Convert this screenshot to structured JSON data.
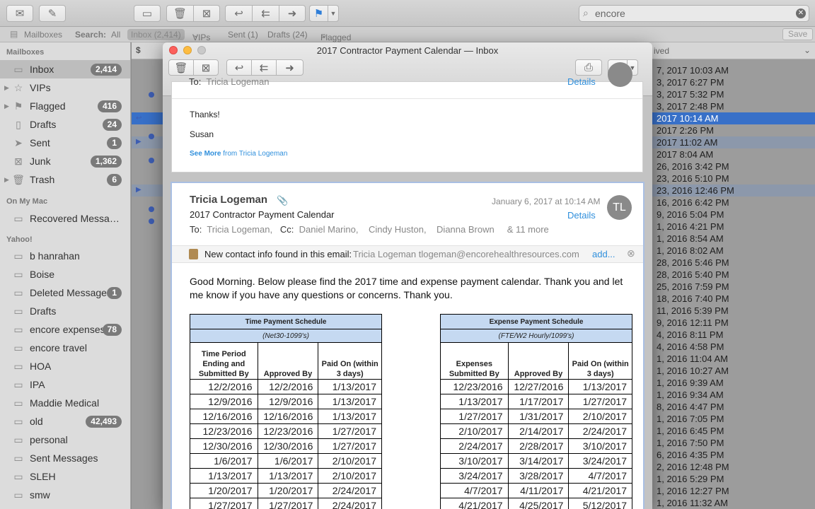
{
  "toolbar": {
    "search_value": "encore"
  },
  "favorites_bar": {
    "mailboxes": "Mailboxes",
    "search_label": "Search:",
    "all": "All",
    "inbox": "Inbox (2,414)",
    "vips": "VIPs",
    "sent": "Sent (1)",
    "drafts": "Drafts (24)",
    "flagged": "Flagged",
    "save": "Save"
  },
  "sidebar": {
    "mailboxes_heading": "Mailboxes",
    "mailboxes": [
      {
        "label": "Inbox",
        "badge": "2,414",
        "icon": "inbox-icon"
      },
      {
        "label": "VIPs",
        "badge": "",
        "icon": "star-icon"
      },
      {
        "label": "Flagged",
        "badge": "416",
        "icon": "flag-icon"
      },
      {
        "label": "Drafts",
        "badge": "24",
        "icon": "document-icon"
      },
      {
        "label": "Sent",
        "badge": "1",
        "icon": "paper-plane-icon"
      },
      {
        "label": "Junk",
        "badge": "1,362",
        "icon": "junk-icon"
      },
      {
        "label": "Trash",
        "badge": "6",
        "icon": "trash-icon"
      }
    ],
    "on_my_mac_heading": "On My Mac",
    "on_my_mac": [
      {
        "label": "Recovered Messages",
        "badge": ""
      }
    ],
    "yahoo_heading": "Yahoo!",
    "yahoo": [
      {
        "label": "b hanrahan",
        "badge": ""
      },
      {
        "label": "Boise",
        "badge": ""
      },
      {
        "label": "Deleted Messages",
        "badge": "1"
      },
      {
        "label": "Drafts",
        "badge": ""
      },
      {
        "label": "encore expenses",
        "badge": "78"
      },
      {
        "label": "encore travel",
        "badge": ""
      },
      {
        "label": "HOA",
        "badge": ""
      },
      {
        "label": "IPA",
        "badge": ""
      },
      {
        "label": "Maddie Medical",
        "badge": ""
      },
      {
        "label": "old",
        "badge": "42,493"
      },
      {
        "label": "personal",
        "badge": ""
      },
      {
        "label": "Sent Messages",
        "badge": ""
      },
      {
        "label": "SLEH",
        "badge": ""
      },
      {
        "label": "smw",
        "badge": ""
      }
    ]
  },
  "message_list": {
    "column_received": "ived",
    "rows": [
      {
        "date": "7, 2017  10:03 AM"
      },
      {
        "date": "3, 2017  6:27 PM"
      },
      {
        "date": "3, 2017  5:32 PM"
      },
      {
        "date": "3, 2017  2:48 PM"
      },
      {
        "date": "2017  10:14 AM"
      },
      {
        "date": "2017  2:26 PM"
      },
      {
        "date": "2017  11:02 AM"
      },
      {
        "date": "2017  8:04 AM"
      },
      {
        "date": "26, 2016  3:42 PM"
      },
      {
        "date": "23, 2016  5:10 PM"
      },
      {
        "date": "23, 2016  12:46 PM"
      },
      {
        "date": "16, 2016  6:42 PM"
      },
      {
        "date": "9, 2016  5:04 PM"
      },
      {
        "date": "1, 2016  4:21 PM"
      },
      {
        "date": "1, 2016  8:54 AM"
      },
      {
        "date": "1, 2016  8:02 AM"
      },
      {
        "date": "28, 2016  5:46 PM"
      },
      {
        "date": "28, 2016  5:40 PM"
      },
      {
        "date": "25, 2016  7:59 PM"
      },
      {
        "date": "18, 2016  7:40 PM"
      },
      {
        "date": "11, 2016  5:39 PM"
      },
      {
        "date": "9, 2016  12:11 PM"
      },
      {
        "date": "4, 2016  8:11 PM"
      },
      {
        "date": "4, 2016  4:58 PM"
      },
      {
        "date": "1, 2016  11:04 AM"
      },
      {
        "date": "1, 2016  10:27 AM"
      },
      {
        "date": "1, 2016  9:39 AM"
      },
      {
        "date": "1, 2016  9:34 AM"
      },
      {
        "date": "8, 2016  4:47 PM"
      },
      {
        "date": "1, 2016  7:05 PM"
      },
      {
        "date": "1, 2016  6:45 PM"
      },
      {
        "date": "1, 2016  7:50 PM"
      },
      {
        "date": "6, 2016  4:35 PM"
      },
      {
        "date": "2, 2016  12:48 PM"
      },
      {
        "date": "1, 2016  5:29 PM"
      },
      {
        "date": "1, 2016  12:27 PM"
      },
      {
        "date": "1, 2016  11:32 AM"
      }
    ]
  },
  "window": {
    "title": "2017 Contractor Payment Calendar — Inbox"
  },
  "prev_message": {
    "to_label": "To:",
    "to": "Tricia Logeman",
    "details": "Details",
    "line1": "Thanks!",
    "line2": "Susan",
    "see_more": "See More",
    "from_text": "from Tricia Logeman"
  },
  "message": {
    "sender": "Tricia Logeman",
    "subject": "2017 Contractor Payment Calendar",
    "date": "January 6, 2017 at 10:14 AM",
    "details": "Details",
    "avatar": "TL",
    "to_label": "To:",
    "to": "Tricia Logeman,",
    "cc_label": "Cc:",
    "cc": [
      "Daniel Marino,",
      "Cindy Huston,",
      "Dianna Brown"
    ],
    "more": "& 11 more",
    "contact_banner": "New contact info found in this email:",
    "contact_info": "Tricia Logeman tlogeman@encorehealthresources.com",
    "add": "add...",
    "body": "Good Morning.  Below please find the 2017 time and expense payment calendar.  Thank you and let me know if you have any questions or concerns.  Thank you."
  },
  "time_table": {
    "title": "Time Payment Schedule",
    "subtitle": "(Net30-1099's)",
    "headers": [
      "Time Period Ending and Submitted By",
      "Approved By",
      "Paid On (within 3 days)"
    ],
    "rows": [
      [
        "12/2/2016",
        "12/2/2016",
        "1/13/2017"
      ],
      [
        "12/9/2016",
        "12/9/2016",
        "1/13/2017"
      ],
      [
        "12/16/2016",
        "12/16/2016",
        "1/13/2017"
      ],
      [
        "12/23/2016",
        "12/23/2016",
        "1/27/2017"
      ],
      [
        "12/30/2016",
        "12/30/2016",
        "1/27/2017"
      ],
      [
        "1/6/2017",
        "1/6/2017",
        "2/10/2017"
      ],
      [
        "1/13/2017",
        "1/13/2017",
        "2/10/2017"
      ],
      [
        "1/20/2017",
        "1/20/2017",
        "2/24/2017"
      ],
      [
        "1/27/2017",
        "1/27/2017",
        "2/24/2017"
      ]
    ]
  },
  "expense_table": {
    "title": "Expense Payment Schedule",
    "subtitle": "(FTE/W2 Hourly/1099's)",
    "headers": [
      "Expenses Submitted By",
      "Approved By",
      "Paid On (within 3 days)"
    ],
    "rows": [
      [
        "12/23/2016",
        "12/27/2016",
        "1/13/2017"
      ],
      [
        "1/13/2017",
        "1/17/2017",
        "1/27/2017"
      ],
      [
        "1/27/2017",
        "1/31/2017",
        "2/10/2017"
      ],
      [
        "2/10/2017",
        "2/14/2017",
        "2/24/2017"
      ],
      [
        "2/24/2017",
        "2/28/2017",
        "3/10/2017"
      ],
      [
        "3/10/2017",
        "3/14/2017",
        "3/24/2017"
      ],
      [
        "3/24/2017",
        "3/28/2017",
        "4/7/2017"
      ],
      [
        "4/7/2017",
        "4/11/2017",
        "4/21/2017"
      ],
      [
        "4/21/2017",
        "4/25/2017",
        "5/12/2017"
      ]
    ]
  }
}
